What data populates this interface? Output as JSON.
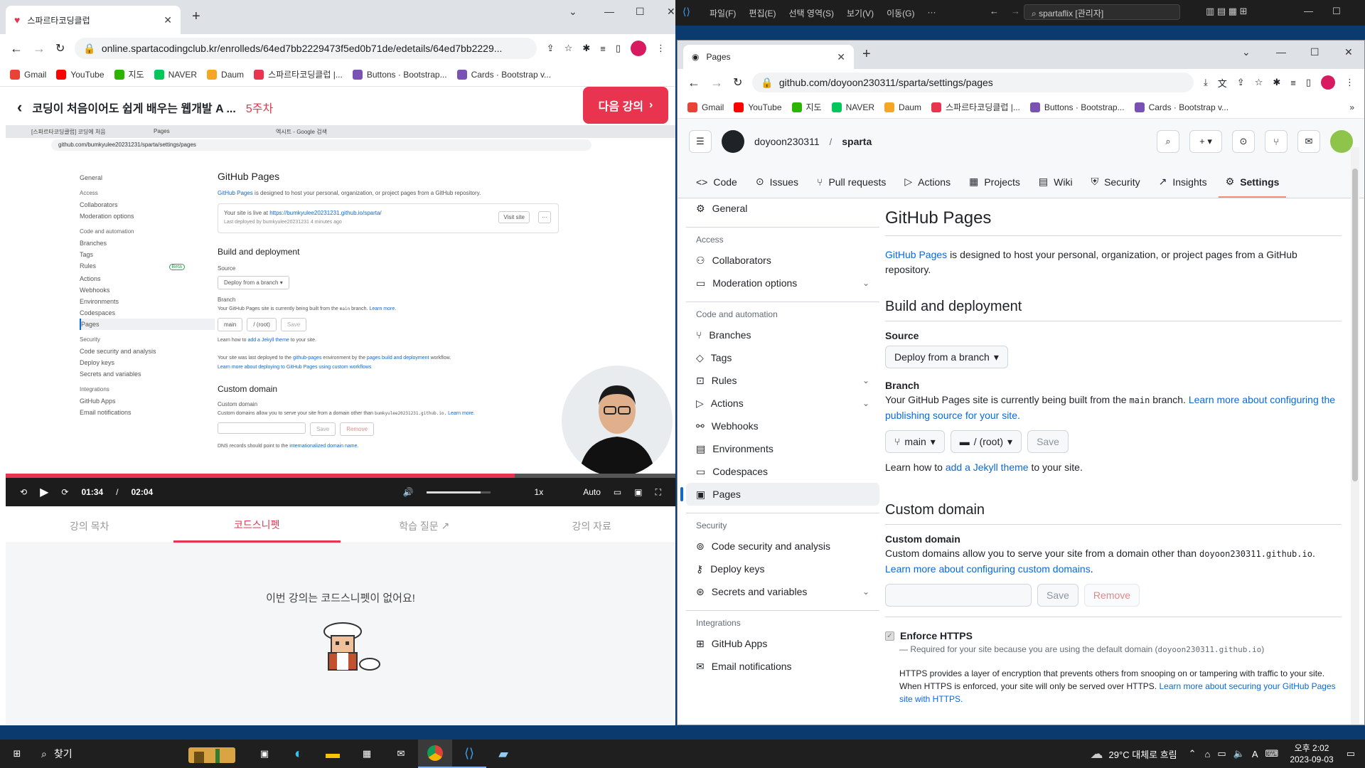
{
  "left_browser": {
    "tab_title": "스파르타코딩클럽",
    "address": "online.spartacodingclub.kr/enrolleds/64ed7bb2229473f5ed0b71de/edetails/64ed7bb2229...",
    "bookmarks": [
      "Gmail",
      "YouTube",
      "지도",
      "NAVER",
      "Daum",
      "스파르타코딩클럽 |...",
      "Buttons · Bootstrap...",
      "Cards · Bootstrap v..."
    ],
    "course_title": "코딩이 처음이어도 쉽게 배우는 웹개발 A ...",
    "week": "5주차",
    "next_button": "다음 강의",
    "video": {
      "tab1": "[스파르타코딩클럽] 코딩에 처음",
      "tab2": "Pages",
      "tab3": "엑시트 - Google 검색",
      "address": "github.com/bumkyulee20231231/sparta/settings/pages",
      "side_general": "General",
      "side_access": "Access",
      "side_collab": "Collaborators",
      "side_moder": "Moderation options",
      "side_code": "Code and automation",
      "side_items": [
        "Branches",
        "Tags",
        "Rules",
        "Actions",
        "Webhooks",
        "Environments",
        "Codespaces",
        "Pages"
      ],
      "side_beta": "Beta",
      "side_security": "Security",
      "side_sec_items": [
        "Code security and analysis",
        "Deploy keys",
        "Secrets and variables"
      ],
      "side_integrations": "Integrations",
      "side_int_items": [
        "GitHub Apps",
        "Email notifications"
      ],
      "h_pages": "GitHub Pages",
      "pages_link": "GitHub Pages",
      "pages_desc": "is designed to host your personal, organization, or project pages from a GitHub repository.",
      "live_text": "Your site is live at",
      "live_url": "https://bumkyulee20231231.github.io/sparta/",
      "deployed": "Last deployed by",
      "deployed_user": "bumkyulee20231231 4 minutes ago",
      "visit": "Visit site",
      "h_build": "Build and deployment",
      "source": "Source",
      "deploy_from": "Deploy from a branch",
      "branch": "Branch",
      "branch_desc1": "Your GitHub Pages site is currently being built from the",
      "branch_main": "main",
      "branch_desc2": "branch.",
      "learn_more": "Learn more.",
      "main_btn": "main",
      "root_btn": "/ (root)",
      "save": "Save",
      "jekyll1": "Learn how to",
      "jekyll_link": "add a Jekyll theme",
      "jekyll2": "to your site.",
      "deploy_note1": "Your site was last deployed to the",
      "deploy_note_env": "github-pages",
      "deploy_note2": "environment by the",
      "deploy_note_wf": "pages build and deployment",
      "deploy_note3": "workflow.",
      "deploy_more": "Learn more about deploying to GitHub Pages using custom workflows",
      "h_custom": "Custom domain",
      "custom_lbl": "Custom domain",
      "custom_desc": "Custom domains allow you to serve your site from a domain other than",
      "custom_domain": "bumkyulee20231231.github.io.",
      "custom_more": "Learn more.",
      "remove": "Remove",
      "dns1": "DNS records should point to the",
      "dns_link": "internationalized domain name."
    },
    "controls": {
      "current_time": "01:34",
      "separator": "/",
      "duration": "02:04",
      "speed": "1x",
      "quality": "Auto",
      "progress": 0.76,
      "volume": 0.85
    },
    "tabs": [
      "강의 목차",
      "코드스니펫",
      "학습 질문",
      "강의 자료"
    ],
    "active_tab": 1,
    "empty_message": "이번 강의는 코드스니펫이 없어요!"
  },
  "vscode": {
    "menus": [
      "파일(F)",
      "편집(E)",
      "선택 영역(S)",
      "보기(V)",
      "이동(G)",
      "···"
    ],
    "search": "spartaflix [관리자]"
  },
  "right_browser": {
    "tab_title": "Pages",
    "address": "github.com/doyoon230311/sparta/settings/pages",
    "bookmarks": [
      "Gmail",
      "YouTube",
      "지도",
      "NAVER",
      "Daum",
      "스파르타코딩클럽 |...",
      "Buttons · Bootstrap...",
      "Cards · Bootstrap v..."
    ],
    "owner": "doyoon230311",
    "slash": "/",
    "repo": "sparta",
    "nav": [
      "Code",
      "Issues",
      "Pull requests",
      "Actions",
      "Projects",
      "Wiki",
      "Security",
      "Insights",
      "Settings"
    ],
    "sidebar": {
      "general": "General",
      "access": "Access",
      "collab": "Collaborators",
      "moder": "Moderation options",
      "code": "Code and automation",
      "code_items": [
        "Branches",
        "Tags",
        "Rules",
        "Actions",
        "Webhooks",
        "Environments",
        "Codespaces",
        "Pages"
      ],
      "security": "Security",
      "sec_items": [
        "Code security and analysis",
        "Deploy keys",
        "Secrets and variables"
      ],
      "integrations": "Integrations",
      "int_items": [
        "GitHub Apps",
        "Email notifications"
      ]
    },
    "content": {
      "title": "GitHub Pages",
      "intro_link": "GitHub Pages",
      "intro": "is designed to host your personal, organization, or project pages from a GitHub repository.",
      "build_title": "Build and deployment",
      "source": "Source",
      "deploy_from": "Deploy from a branch",
      "branch": "Branch",
      "branch_desc1": "Your GitHub Pages site is currently being built from the",
      "branch_main": "main",
      "branch_desc2": "branch.",
      "branch_more": "Learn more about configuring the publishing source for your site",
      "main_btn": "main",
      "root_btn": "/ (root)",
      "save": "Save",
      "jekyll1": "Learn how to",
      "jekyll_link": "add a Jekyll theme",
      "jekyll2": "to your site.",
      "custom_title": "Custom domain",
      "custom_lbl": "Custom domain",
      "custom_desc": "Custom domains allow you to serve your site from a domain other than",
      "custom_domain": "doyoon230311.github.io",
      "custom_more": "Learn more about configuring custom domains",
      "custom_placeholder": "",
      "remove": "Remove",
      "https_lbl": "Enforce HTTPS",
      "https_req1": "— Required for your site because you are using the default domain (",
      "https_req_domain": "doyoon230311.github.io",
      "https_req2": ")",
      "https_desc": "HTTPS provides a layer of encryption that prevents others from snooping on or tampering with traffic to your site. When HTTPS is enforced, your site will only be served over HTTPS.",
      "https_more": "Learn more about securing your GitHub Pages site with HTTPS"
    }
  },
  "taskbar": {
    "search": "찾기",
    "weather": "29°C 대체로 흐림",
    "time": "오후 2:02",
    "date": "2023-09-03"
  },
  "colors": {
    "spartaRed": "#e8344e",
    "ghBlue": "#0969da",
    "taskbar": "#1f1f1f"
  }
}
